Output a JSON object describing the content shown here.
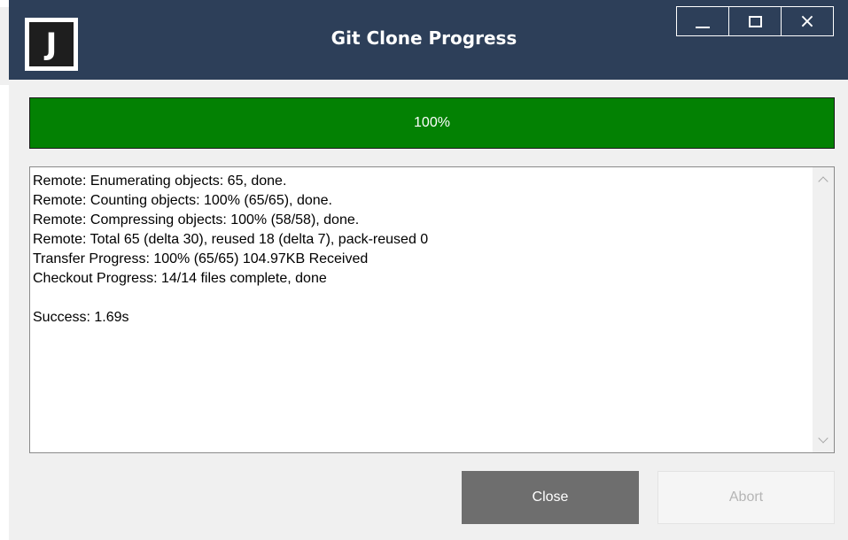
{
  "window": {
    "title": "Git Clone Progress",
    "logo_letter": "J",
    "controls": {
      "minimize": "minimize",
      "maximize": "maximize",
      "close": "×"
    }
  },
  "progress": {
    "label": "100%",
    "value": 100,
    "fill_color": "#038103"
  },
  "log": {
    "lines": [
      "Remote: Enumerating objects: 65, done.",
      "Remote: Counting objects: 100% (65/65), done.",
      "Remote: Compressing objects: 100% (58/58), done.",
      "Remote: Total 65 (delta 30), reused 18 (delta 7), pack-reused 0",
      "Transfer Progress: 100% (65/65) 104.97KB Received",
      "Checkout Progress: 14/14 files complete, done",
      "",
      "Success: 1.69s"
    ]
  },
  "buttons": {
    "close_label": "Close",
    "abort_label": "Abort"
  },
  "colors": {
    "title_bar": "#2d3f59",
    "progress": "#038103",
    "close_button": "#6e6e6e",
    "abort_disabled_text": "#b5b5b5"
  }
}
